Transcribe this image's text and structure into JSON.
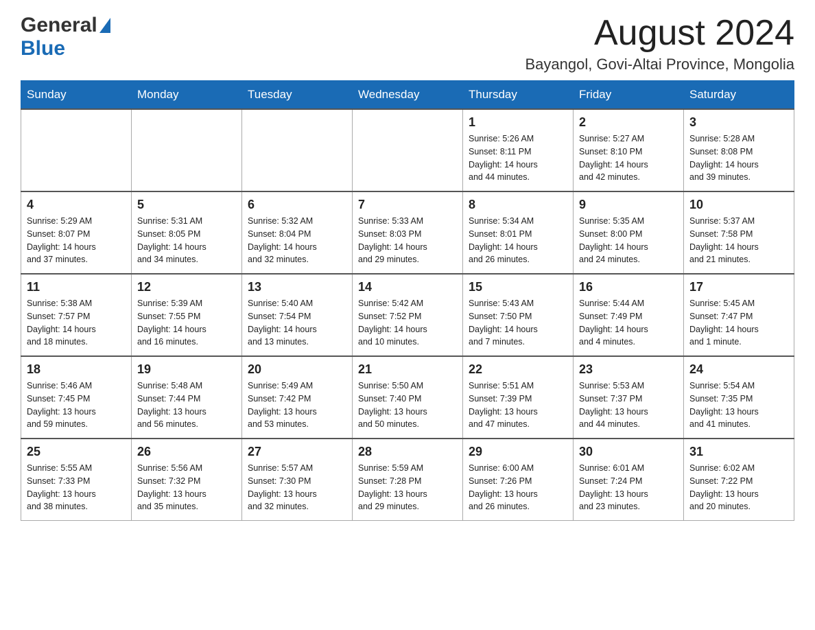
{
  "header": {
    "logo_general": "General",
    "logo_blue": "Blue",
    "month_title": "August 2024",
    "location": "Bayangol, Govi-Altai Province, Mongolia"
  },
  "weekdays": [
    "Sunday",
    "Monday",
    "Tuesday",
    "Wednesday",
    "Thursday",
    "Friday",
    "Saturday"
  ],
  "weeks": [
    [
      {
        "day": "",
        "info": ""
      },
      {
        "day": "",
        "info": ""
      },
      {
        "day": "",
        "info": ""
      },
      {
        "day": "",
        "info": ""
      },
      {
        "day": "1",
        "info": "Sunrise: 5:26 AM\nSunset: 8:11 PM\nDaylight: 14 hours\nand 44 minutes."
      },
      {
        "day": "2",
        "info": "Sunrise: 5:27 AM\nSunset: 8:10 PM\nDaylight: 14 hours\nand 42 minutes."
      },
      {
        "day": "3",
        "info": "Sunrise: 5:28 AM\nSunset: 8:08 PM\nDaylight: 14 hours\nand 39 minutes."
      }
    ],
    [
      {
        "day": "4",
        "info": "Sunrise: 5:29 AM\nSunset: 8:07 PM\nDaylight: 14 hours\nand 37 minutes."
      },
      {
        "day": "5",
        "info": "Sunrise: 5:31 AM\nSunset: 8:05 PM\nDaylight: 14 hours\nand 34 minutes."
      },
      {
        "day": "6",
        "info": "Sunrise: 5:32 AM\nSunset: 8:04 PM\nDaylight: 14 hours\nand 32 minutes."
      },
      {
        "day": "7",
        "info": "Sunrise: 5:33 AM\nSunset: 8:03 PM\nDaylight: 14 hours\nand 29 minutes."
      },
      {
        "day": "8",
        "info": "Sunrise: 5:34 AM\nSunset: 8:01 PM\nDaylight: 14 hours\nand 26 minutes."
      },
      {
        "day": "9",
        "info": "Sunrise: 5:35 AM\nSunset: 8:00 PM\nDaylight: 14 hours\nand 24 minutes."
      },
      {
        "day": "10",
        "info": "Sunrise: 5:37 AM\nSunset: 7:58 PM\nDaylight: 14 hours\nand 21 minutes."
      }
    ],
    [
      {
        "day": "11",
        "info": "Sunrise: 5:38 AM\nSunset: 7:57 PM\nDaylight: 14 hours\nand 18 minutes."
      },
      {
        "day": "12",
        "info": "Sunrise: 5:39 AM\nSunset: 7:55 PM\nDaylight: 14 hours\nand 16 minutes."
      },
      {
        "day": "13",
        "info": "Sunrise: 5:40 AM\nSunset: 7:54 PM\nDaylight: 14 hours\nand 13 minutes."
      },
      {
        "day": "14",
        "info": "Sunrise: 5:42 AM\nSunset: 7:52 PM\nDaylight: 14 hours\nand 10 minutes."
      },
      {
        "day": "15",
        "info": "Sunrise: 5:43 AM\nSunset: 7:50 PM\nDaylight: 14 hours\nand 7 minutes."
      },
      {
        "day": "16",
        "info": "Sunrise: 5:44 AM\nSunset: 7:49 PM\nDaylight: 14 hours\nand 4 minutes."
      },
      {
        "day": "17",
        "info": "Sunrise: 5:45 AM\nSunset: 7:47 PM\nDaylight: 14 hours\nand 1 minute."
      }
    ],
    [
      {
        "day": "18",
        "info": "Sunrise: 5:46 AM\nSunset: 7:45 PM\nDaylight: 13 hours\nand 59 minutes."
      },
      {
        "day": "19",
        "info": "Sunrise: 5:48 AM\nSunset: 7:44 PM\nDaylight: 13 hours\nand 56 minutes."
      },
      {
        "day": "20",
        "info": "Sunrise: 5:49 AM\nSunset: 7:42 PM\nDaylight: 13 hours\nand 53 minutes."
      },
      {
        "day": "21",
        "info": "Sunrise: 5:50 AM\nSunset: 7:40 PM\nDaylight: 13 hours\nand 50 minutes."
      },
      {
        "day": "22",
        "info": "Sunrise: 5:51 AM\nSunset: 7:39 PM\nDaylight: 13 hours\nand 47 minutes."
      },
      {
        "day": "23",
        "info": "Sunrise: 5:53 AM\nSunset: 7:37 PM\nDaylight: 13 hours\nand 44 minutes."
      },
      {
        "day": "24",
        "info": "Sunrise: 5:54 AM\nSunset: 7:35 PM\nDaylight: 13 hours\nand 41 minutes."
      }
    ],
    [
      {
        "day": "25",
        "info": "Sunrise: 5:55 AM\nSunset: 7:33 PM\nDaylight: 13 hours\nand 38 minutes."
      },
      {
        "day": "26",
        "info": "Sunrise: 5:56 AM\nSunset: 7:32 PM\nDaylight: 13 hours\nand 35 minutes."
      },
      {
        "day": "27",
        "info": "Sunrise: 5:57 AM\nSunset: 7:30 PM\nDaylight: 13 hours\nand 32 minutes."
      },
      {
        "day": "28",
        "info": "Sunrise: 5:59 AM\nSunset: 7:28 PM\nDaylight: 13 hours\nand 29 minutes."
      },
      {
        "day": "29",
        "info": "Sunrise: 6:00 AM\nSunset: 7:26 PM\nDaylight: 13 hours\nand 26 minutes."
      },
      {
        "day": "30",
        "info": "Sunrise: 6:01 AM\nSunset: 7:24 PM\nDaylight: 13 hours\nand 23 minutes."
      },
      {
        "day": "31",
        "info": "Sunrise: 6:02 AM\nSunset: 7:22 PM\nDaylight: 13 hours\nand 20 minutes."
      }
    ]
  ]
}
